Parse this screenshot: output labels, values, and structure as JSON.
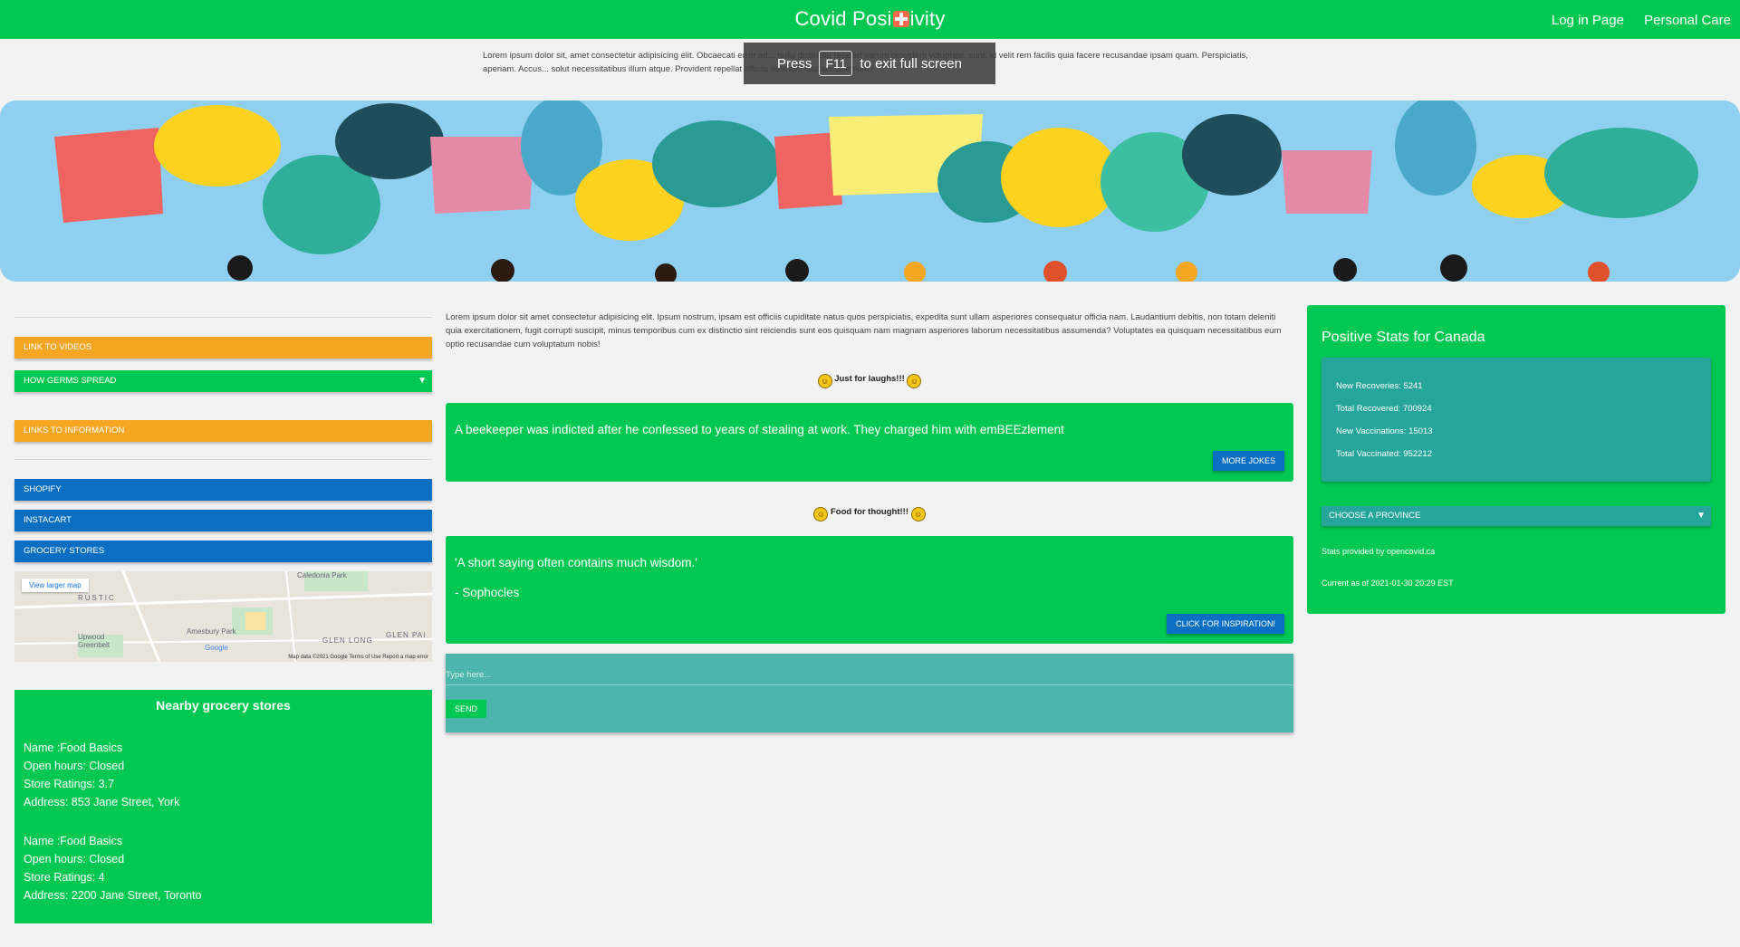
{
  "nav": {
    "brand_left": "Covid Posi",
    "brand_right": "ivity",
    "links": [
      "Log in Page",
      "Personal Care"
    ]
  },
  "intro_text": "Lorem ipsum dolor sit, amet consectetur adipisicing elit. Obcaecati error ad... nulla distinctio repellat earum provident voluptate, sunt, id velit rem facilis quia facere recusandae ipsam quam. Perspiciatis, aperiam. Accus... solut necessitatibus illum atque. Provident repellat officiis nesciunt iste accusantium?",
  "fullscreen_hint": {
    "press": "Press",
    "key": "F11",
    "rest": "to exit full screen"
  },
  "sidebar": {
    "link_videos": "LINK TO VIDEOS",
    "germs": "HOW GERMS SPREAD",
    "link_info": "LINKS TO INFORMATION",
    "shopify": "SHOPIFY",
    "instacart": "INSTACART",
    "grocery": "GROCERY STORES"
  },
  "map": {
    "view_larger": "View larger map",
    "footer": "Map data ©2021 Google   Terms of Use   Report a map error",
    "labels": [
      "Caledonia Park",
      "RUSTIC",
      "Upwood Greenbelt",
      "Amesbury Park",
      "GLEN LONG",
      "GLEN PAI",
      "Google"
    ]
  },
  "nearby": {
    "title": "Nearby grocery stores",
    "stores": [
      {
        "name": "Name :Food Basics",
        "hours": "Open hours: Closed",
        "rating": "Store Ratings: 3.7",
        "address": "Address: 853 Jane Street, York"
      },
      {
        "name": "Name :Food Basics",
        "hours": "Open hours: Closed",
        "rating": "Store Ratings: 4",
        "address": "Address: 2200 Jane Street, Toronto"
      }
    ]
  },
  "center": {
    "para": "Lorem ipsum dolor sit amet consectetur adipisicing elit. Ipsum nostrum, ipsam est officiis cupiditate natus quos perspiciatis, expedita sunt ullam asperiores consequatur officia nam. Laudantium debitis, non totam deleniti quia exercitationem, fugit corrupti suscipit, minus temporibus cum ex distinctio sint reiciendis sunt eos quisquam nam magnam asperiores laborum necessitatibus assumenda? Voluptates ea quisquam necessitatibus eum optio recusandae cum voluptatum nobis!",
    "laughs_heading": "Just for laughs!!!",
    "joke": "A beekeeper was indicted after he confessed to years of stealing at work. They charged him with emBEEzlement",
    "more_jokes": "MORE JOKES",
    "thought_heading": "Food for thought!!!",
    "quote": "'A short saying often contains much wisdom.'",
    "author": "- Sophocles",
    "inspire": "CLICK FOR INSPIRATION!",
    "chat_placeholder": "Type here...",
    "send": "SEND"
  },
  "stats": {
    "title": "Positive Stats for Canada",
    "new_recoveries": "New Recoveries: 5241",
    "total_recovered": "Total Recovered: 700924",
    "new_vaccinations": "New Vaccinations: 15013",
    "total_vaccinated": "Total Vaccinated: 952212",
    "province": "CHOOSE A PROVINCE",
    "provider": "Stats provided by opencovid.ca",
    "current": "Current as of 2021-01-30 20:29 EST"
  },
  "colors": {
    "primary_green": "#00c853",
    "teal": "#26a69a",
    "orange": "#f5a623",
    "blue": "#0a6fc2"
  }
}
